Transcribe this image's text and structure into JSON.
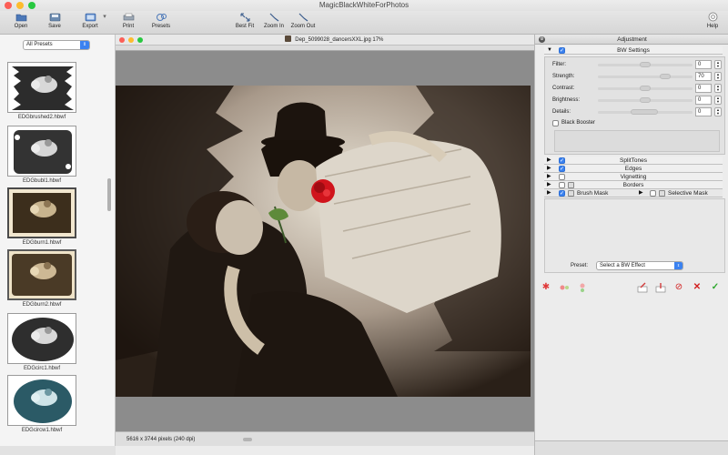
{
  "window": {
    "title": "MagicBlackWhiteForPhotos"
  },
  "toolbar": {
    "open": "Open",
    "save": "Save",
    "export": "Export",
    "print": "Print",
    "presets": "Presets",
    "best_fit": "Best Fit",
    "zoom_in": "Zoom In",
    "zoom_out": "Zoom Out",
    "help": "Help"
  },
  "sidebar": {
    "preset_filter": "All Presets",
    "thumbnails": [
      {
        "label": "EDGbrushed2.hbwf"
      },
      {
        "label": "EDGbubl1.hbwf"
      },
      {
        "label": "EDGburn1.hbwf"
      },
      {
        "label": "EDGburn2.hbwf"
      },
      {
        "label": "EDGcirc1.hbwf"
      },
      {
        "label": "EDGcircw1.hbwf"
      }
    ]
  },
  "viewer": {
    "title": "Dep_5099028_dancersXXL.jpg 17%",
    "status": "5616 x 3744 pixels (240 dpi)"
  },
  "adjustment": {
    "header": "Adjustment",
    "bw_settings": {
      "title": "BW Settings",
      "filter_label": "Filter:",
      "filter_value": "0",
      "strength_label": "Strength:",
      "strength_value": "70",
      "contrast_label": "Contrast:",
      "contrast_value": "0",
      "brightness_label": "Brightness:",
      "brightness_value": "0",
      "details_label": "Details:",
      "details_value": "0",
      "black_booster": "Black Booster"
    },
    "sections": {
      "splittones": "SplitTones",
      "edges": "Edges",
      "vignetting": "Vignetting",
      "borders": "Borders",
      "brush_mask": "Brush Mask",
      "selective_mask": "Selective Mask"
    },
    "preset_label": "Preset:",
    "preset_value": "Select a BW Effect"
  },
  "colors": {
    "accent": "#3b82f0",
    "rose": "#d0141c",
    "cancel": "#d21f1f",
    "confirm": "#2ea82e"
  }
}
